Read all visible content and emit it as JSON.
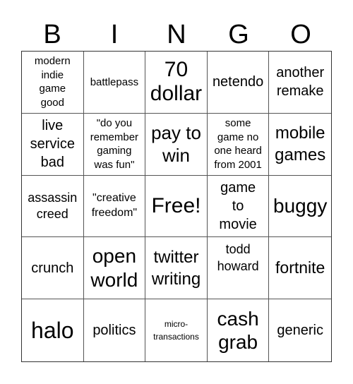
{
  "header": [
    "B",
    "I",
    "N",
    "G",
    "O"
  ],
  "cells": [
    "modern indie game good",
    "battlepass",
    "70 dollar",
    "netendo",
    "another remake",
    "live service bad",
    "\"do you remember gaming was fun\"",
    "pay to win",
    "some game no one heard from 2001",
    "mobile games",
    "assassin creed",
    "\"creative freedom\"",
    "Free!",
    "game to movie",
    "buggy",
    "crunch",
    "open world",
    "twitter writing",
    "todd howard",
    "fortnite",
    "halo",
    "politics",
    "micro-transactions",
    "cash grab",
    "generic"
  ]
}
